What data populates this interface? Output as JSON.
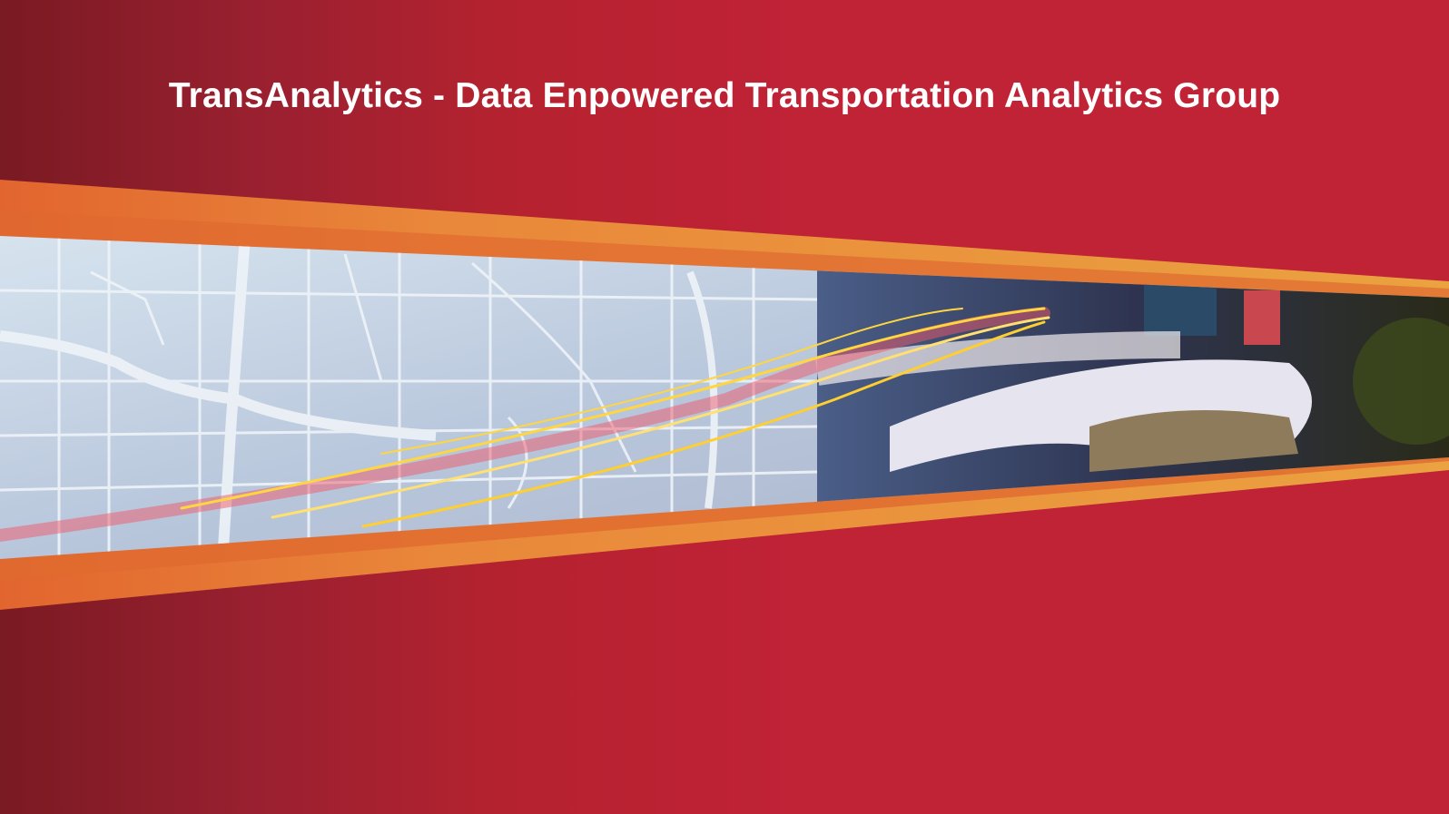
{
  "header": {
    "title": "TransAnalytics - Data Enpowered Transportation Analytics Group"
  },
  "colors": {
    "background": "#c02236",
    "band": "#e8913a",
    "band_dark": "#e06a30"
  }
}
